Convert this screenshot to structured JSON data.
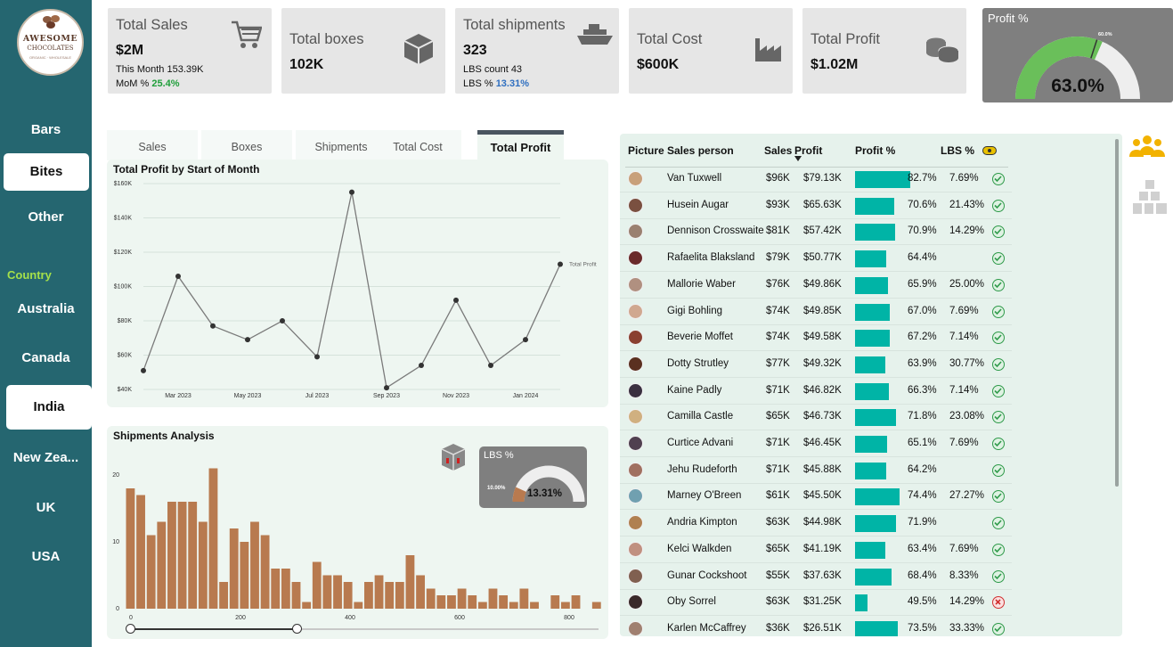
{
  "logo": {
    "line1": "AWESOME",
    "line2": "CHOCOLATES",
    "line3": "ORGANIC · WHOLESALE"
  },
  "nav": {
    "bars": "Bars",
    "bites": "Bites",
    "other": "Other"
  },
  "country": {
    "label": "Country",
    "items": [
      "Australia",
      "Canada",
      "India",
      "New Zea...",
      "UK",
      "USA"
    ]
  },
  "kpis": {
    "sales": {
      "title": "Total Sales",
      "value": "$2M",
      "sub1": "This Month 153.39K",
      "sub2_label": "MoM % ",
      "sub2_value": "25.4%"
    },
    "boxes": {
      "title": "Total boxes",
      "value": "102K"
    },
    "shipments": {
      "title": "Total shipments",
      "value": "323",
      "sub1": "LBS count 43",
      "sub2_label": "LBS % ",
      "sub2_value": "13.31%"
    },
    "cost": {
      "title": "Total Cost",
      "value": "$600K"
    },
    "profit": {
      "title": "Total Profit",
      "value": "$1.02M"
    }
  },
  "profit_gauge": {
    "title": "Profit %",
    "value": "63.0%",
    "target_label": "60.0%",
    "fraction": 0.63,
    "target_fraction": 0.6
  },
  "tabs": [
    "Sales",
    "Boxes",
    "Shipments",
    "Total Cost",
    "Total Profit"
  ],
  "colors": {
    "sidebar": "#256670",
    "accent_bar": "#00b4a6",
    "hist_bar": "#b87a4f",
    "gauge_fill": "#6abf5a"
  },
  "chart_data": [
    {
      "type": "line",
      "title": "Total Profit by Start of Month",
      "series": [
        {
          "name": "Total Profit",
          "values": [
            51000,
            106000,
            77000,
            69000,
            80000,
            59000,
            155000,
            41000,
            54000,
            92000,
            54000,
            69000,
            113000
          ]
        }
      ],
      "x": [
        "2023-02",
        "2023-03",
        "2023-04",
        "2023-05",
        "2023-06",
        "2023-07",
        "2023-08",
        "2023-09",
        "2023-10",
        "2023-11",
        "2023-12",
        "2024-01",
        "2024-02"
      ],
      "xticks": [
        "Mar 2023",
        "May 2023",
        "Jul 2023",
        "Sep 2023",
        "Nov 2023",
        "Jan 2024"
      ],
      "yticks": [
        "$40K",
        "$60K",
        "$80K",
        "$100K",
        "$120K",
        "$140K",
        "$160K"
      ],
      "ylim": [
        40000,
        160000
      ],
      "grid": true
    },
    {
      "type": "bar",
      "title": "Shipments Analysis",
      "values": [
        18,
        17,
        11,
        13,
        16,
        16,
        16,
        13,
        21,
        4,
        12,
        10,
        13,
        11,
        6,
        6,
        4,
        1,
        7,
        5,
        5,
        4,
        1,
        4,
        5,
        4,
        4,
        8,
        5,
        3,
        2,
        2,
        3,
        2,
        1,
        3,
        2,
        1,
        3,
        1,
        0,
        2,
        1,
        2,
        0,
        1
      ],
      "xticks": [
        "0",
        "200",
        "400",
        "600",
        "800"
      ],
      "yticks": [
        "0",
        "10",
        "20"
      ],
      "ylim": [
        0,
        22
      ]
    }
  ],
  "lbs_gauge": {
    "title": "LBS %",
    "value": "13.31%",
    "target_label": "10.00%",
    "fraction": 0.1331
  },
  "table": {
    "headers": [
      "Picture",
      "Sales person",
      "Sales",
      "Profit",
      "Profit %",
      "LBS %"
    ],
    "rows": [
      {
        "name": "Van Tuxwell",
        "sales": "$96K",
        "profit": "$79.13K",
        "pct": "82.7%",
        "pct_val": 82.7,
        "lbs": "7.69%",
        "ok": true,
        "av": "#c8a07a"
      },
      {
        "name": "Husein Augar",
        "sales": "$93K",
        "profit": "$65.63K",
        "pct": "70.6%",
        "pct_val": 70.6,
        "lbs": "21.43%",
        "ok": true,
        "av": "#7a5040"
      },
      {
        "name": "Dennison Crosswaite",
        "sales": "$81K",
        "profit": "$57.42K",
        "pct": "70.9%",
        "pct_val": 70.9,
        "lbs": "14.29%",
        "ok": true,
        "av": "#9a8070"
      },
      {
        "name": "Rafaelita Blaksland",
        "sales": "$79K",
        "profit": "$50.77K",
        "pct": "64.4%",
        "pct_val": 64.4,
        "lbs": "",
        "ok": true,
        "av": "#6a2a2a"
      },
      {
        "name": "Mallorie Waber",
        "sales": "$76K",
        "profit": "$49.86K",
        "pct": "65.9%",
        "pct_val": 65.9,
        "lbs": "25.00%",
        "ok": true,
        "av": "#b09080"
      },
      {
        "name": "Gigi Bohling",
        "sales": "$74K",
        "profit": "$49.85K",
        "pct": "67.0%",
        "pct_val": 67.0,
        "lbs": "7.69%",
        "ok": true,
        "av": "#d0a890"
      },
      {
        "name": "Beverie Moffet",
        "sales": "$74K",
        "profit": "$49.58K",
        "pct": "67.2%",
        "pct_val": 67.2,
        "lbs": "7.14%",
        "ok": true,
        "av": "#8a4030"
      },
      {
        "name": "Dotty Strutley",
        "sales": "$77K",
        "profit": "$49.32K",
        "pct": "63.9%",
        "pct_val": 63.9,
        "lbs": "30.77%",
        "ok": true,
        "av": "#5a3020"
      },
      {
        "name": "Kaine Padly",
        "sales": "$71K",
        "profit": "$46.82K",
        "pct": "66.3%",
        "pct_val": 66.3,
        "lbs": "7.14%",
        "ok": true,
        "av": "#3a3040"
      },
      {
        "name": "Camilla Castle",
        "sales": "$65K",
        "profit": "$46.73K",
        "pct": "71.8%",
        "pct_val": 71.8,
        "lbs": "23.08%",
        "ok": true,
        "av": "#d0b080"
      },
      {
        "name": "Curtice Advani",
        "sales": "$71K",
        "profit": "$46.45K",
        "pct": "65.1%",
        "pct_val": 65.1,
        "lbs": "7.69%",
        "ok": true,
        "av": "#504050"
      },
      {
        "name": "Jehu Rudeforth",
        "sales": "$71K",
        "profit": "$45.88K",
        "pct": "64.2%",
        "pct_val": 64.2,
        "lbs": "",
        "ok": true,
        "av": "#a07060"
      },
      {
        "name": "Marney O'Breen",
        "sales": "$61K",
        "profit": "$45.50K",
        "pct": "74.4%",
        "pct_val": 74.4,
        "lbs": "27.27%",
        "ok": true,
        "av": "#70a0b0"
      },
      {
        "name": "Andria Kimpton",
        "sales": "$63K",
        "profit": "$44.98K",
        "pct": "71.9%",
        "pct_val": 71.9,
        "lbs": "",
        "ok": true,
        "av": "#b08050"
      },
      {
        "name": "Kelci Walkden",
        "sales": "$65K",
        "profit": "$41.19K",
        "pct": "63.4%",
        "pct_val": 63.4,
        "lbs": "7.69%",
        "ok": true,
        "av": "#c09080"
      },
      {
        "name": "Gunar Cockshoot",
        "sales": "$55K",
        "profit": "$37.63K",
        "pct": "68.4%",
        "pct_val": 68.4,
        "lbs": "8.33%",
        "ok": true,
        "av": "#806050"
      },
      {
        "name": "Oby Sorrel",
        "sales": "$63K",
        "profit": "$31.25K",
        "pct": "49.5%",
        "pct_val": 49.5,
        "lbs": "14.29%",
        "ok": false,
        "av": "#3a2a2a"
      },
      {
        "name": "Karlen McCaffrey",
        "sales": "$36K",
        "profit": "$26.51K",
        "pct": "73.5%",
        "pct_val": 73.5,
        "lbs": "33.33%",
        "ok": true,
        "av": "#a08070"
      }
    ]
  }
}
